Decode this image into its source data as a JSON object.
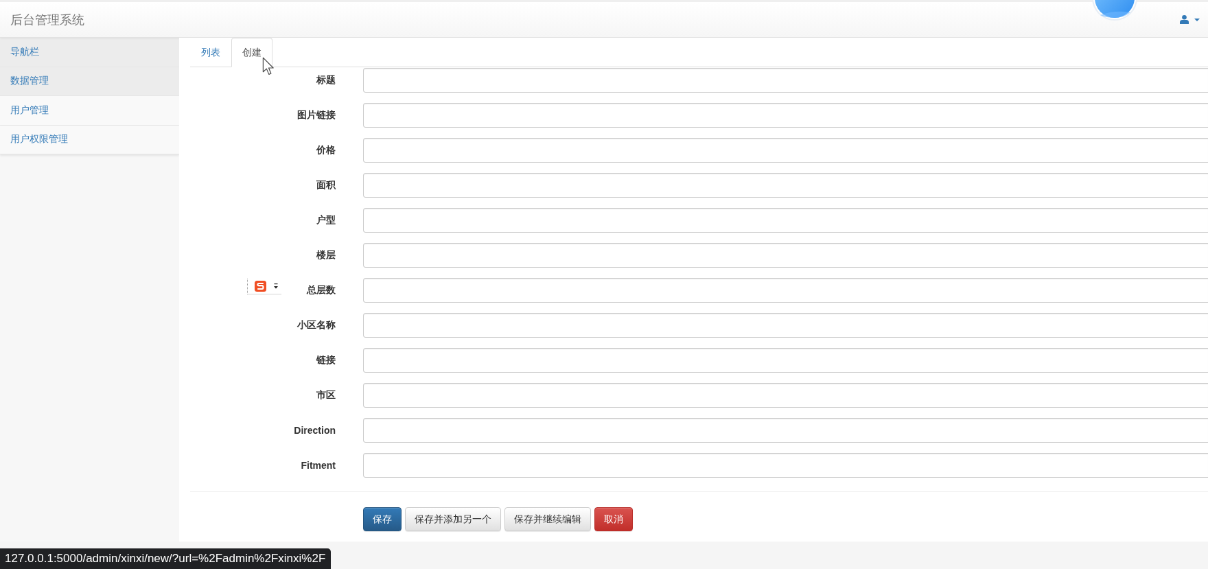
{
  "navbar": {
    "brand": "后台管理系统"
  },
  "sidebar": {
    "header": "导航栏",
    "items": [
      {
        "label": "数据管理",
        "selected": true
      },
      {
        "label": "用户管理",
        "selected": false
      },
      {
        "label": "用户权限管理",
        "selected": false
      }
    ]
  },
  "tabs": [
    {
      "label": "列表",
      "selected": false
    },
    {
      "label": "创建",
      "selected": true
    }
  ],
  "form": {
    "fields": [
      {
        "label": "标题"
      },
      {
        "label": "图片链接"
      },
      {
        "label": "价格"
      },
      {
        "label": "面积"
      },
      {
        "label": "户型"
      },
      {
        "label": "楼层"
      },
      {
        "label": "总层数"
      },
      {
        "label": "小区名称"
      },
      {
        "label": "链接"
      },
      {
        "label": "市区"
      },
      {
        "label": "Direction"
      },
      {
        "label": "Fitment"
      }
    ]
  },
  "buttons": [
    {
      "label": "保存",
      "kind": "primary"
    },
    {
      "label": "保存并添加另一个",
      "kind": "default"
    },
    {
      "label": "保存并继续编辑",
      "kind": "default"
    },
    {
      "label": "取消",
      "kind": "danger"
    }
  ],
  "status_bar": {
    "url": "127.0.0.1:5000/admin/xinxi/new/?url=%2Fadmin%2Fxinxi%2F"
  }
}
